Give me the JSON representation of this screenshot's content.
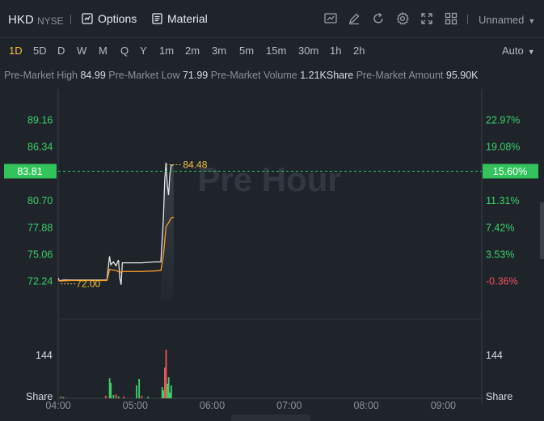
{
  "header": {
    "symbol": "HKD",
    "exchange": "NYSE",
    "options_label": "Options",
    "material_label": "Material",
    "layout_name": "Unnamed"
  },
  "periods": [
    "1D",
    "5D",
    "D",
    "W",
    "M",
    "Q",
    "Y",
    "1m",
    "2m",
    "3m",
    "5m",
    "15m",
    "30m",
    "1h",
    "2h"
  ],
  "active_period": "1D",
  "scale_mode": "Auto",
  "stats": {
    "premarket_high_label": "Pre-Market High",
    "premarket_high": "84.99",
    "premarket_low_label": "Pre-Market Low",
    "premarket_low": "71.99",
    "premarket_volume_label": "Pre-Market Volume",
    "premarket_volume": "1.21KShare",
    "premarket_amount_label": "Pre-Market Amount",
    "premarket_amount": "95.90K"
  },
  "colors": {
    "up": "#3ecf6a",
    "down": "#f0525a",
    "price_line": "#e6e6e6",
    "avg_line": "#f39c2a",
    "highlight": "#f5c243",
    "current_badge": "#32c35c"
  },
  "chart_data": {
    "type": "line",
    "watermark": "Pre Hour",
    "x_ticks": [
      "04:00",
      "05:00",
      "06:00",
      "07:00",
      "08:00",
      "09:00"
    ],
    "x_range": [
      "04:00",
      "09:30"
    ],
    "y_left_ticks": [
      "89.16",
      "86.34",
      "80.70",
      "77.88",
      "75.06",
      "72.24"
    ],
    "y_right_ticks": [
      "22.97%",
      "19.08%",
      "11.31%",
      "7.42%",
      "3.53%",
      "-0.36%"
    ],
    "ylim": [
      71.2,
      90.3
    ],
    "current_price": "83.81",
    "current_change": "15.60%",
    "annotated_high": "84.48",
    "annotated_low": "72.00",
    "volume_tick": "144",
    "volume_axis_label": "Share",
    "volume_ylim": [
      0,
      230
    ],
    "series": [
      {
        "points": [
          [
            "04:00",
            72.6
          ],
          [
            "04:01",
            72.3
          ],
          [
            "04:02",
            72.35
          ],
          [
            "04:04",
            72.4
          ],
          [
            "04:10",
            72.4
          ],
          [
            "04:18",
            72.4
          ],
          [
            "04:30",
            72.4
          ],
          [
            "04:38",
            72.4
          ],
          [
            "04:40",
            74.9
          ],
          [
            "04:41",
            74.0
          ],
          [
            "04:43",
            74.3
          ],
          [
            "04:45",
            73.9
          ],
          [
            "04:47",
            74.5
          ],
          [
            "04:48",
            72.6
          ],
          [
            "04:49",
            71.9
          ],
          [
            "04:50",
            74.2
          ],
          [
            "05:05",
            74.2
          ],
          [
            "05:15",
            74.3
          ],
          [
            "05:20",
            74.3
          ],
          [
            "05:22",
            79.0
          ],
          [
            "05:23",
            82.9
          ],
          [
            "05:24",
            84.7
          ],
          [
            "05:25",
            82.4
          ],
          [
            "05:26",
            81.3
          ],
          [
            "05:27",
            83.5
          ],
          [
            "05:28",
            84.4
          ],
          [
            "05:30",
            84.5
          ]
        ]
      },
      {
        "points": [
          [
            "04:00",
            72.4
          ],
          [
            "04:02",
            72.3
          ],
          [
            "04:10",
            72.35
          ],
          [
            "04:38",
            72.35
          ],
          [
            "04:40",
            73.5
          ],
          [
            "04:45",
            73.4
          ],
          [
            "04:48",
            73.2
          ],
          [
            "04:50",
            73.3
          ],
          [
            "05:05",
            73.3
          ],
          [
            "05:15",
            73.35
          ],
          [
            "05:20",
            73.4
          ],
          [
            "05:22",
            75.0
          ],
          [
            "05:24",
            78.0
          ],
          [
            "05:26",
            78.4
          ],
          [
            "05:28",
            78.9
          ],
          [
            "05:30",
            79.0
          ]
        ]
      }
    ],
    "volume": [
      {
        "t": "04:02",
        "v": 6,
        "up": false
      },
      {
        "t": "04:04",
        "v": 4,
        "up": true
      },
      {
        "t": "04:37",
        "v": 8,
        "up": false
      },
      {
        "t": "04:40",
        "v": 62,
        "up": true
      },
      {
        "t": "04:41",
        "v": 48,
        "up": true
      },
      {
        "t": "04:43",
        "v": 10,
        "up": true
      },
      {
        "t": "04:45",
        "v": 12,
        "up": false
      },
      {
        "t": "04:47",
        "v": 6,
        "up": true
      },
      {
        "t": "04:51",
        "v": 6,
        "up": false
      },
      {
        "t": "05:01",
        "v": 40,
        "up": true
      },
      {
        "t": "05:03",
        "v": 60,
        "up": true
      },
      {
        "t": "05:05",
        "v": 8,
        "up": false
      },
      {
        "t": "05:10",
        "v": 5,
        "up": true
      },
      {
        "t": "05:21",
        "v": 35,
        "up": true
      },
      {
        "t": "05:22",
        "v": 25,
        "up": true
      },
      {
        "t": "05:23",
        "v": 95,
        "up": false
      },
      {
        "t": "05:24",
        "v": 150,
        "up": false
      },
      {
        "t": "05:25",
        "v": 45,
        "up": true
      },
      {
        "t": "05:26",
        "v": 65,
        "up": true
      },
      {
        "t": "05:27",
        "v": 18,
        "up": true
      },
      {
        "t": "05:28",
        "v": 40,
        "up": true
      }
    ]
  }
}
